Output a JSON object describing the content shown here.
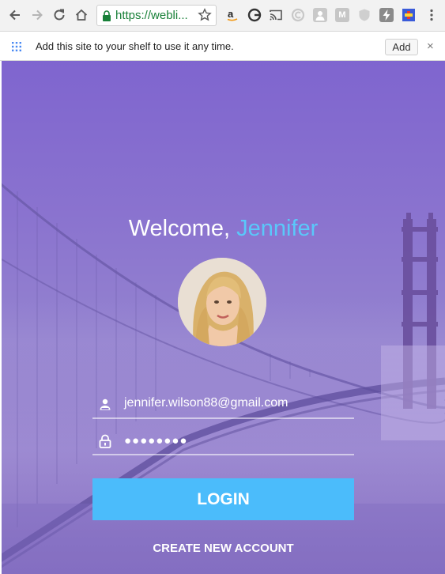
{
  "browser": {
    "url": "https://webli...",
    "extensions": [
      "amazon-icon",
      "grammarly-icon",
      "cast-icon",
      "c-icon",
      "profile-icon",
      "m-icon",
      "shield-icon",
      "lightning-icon",
      "flag-icon"
    ],
    "ext_m_label": "M"
  },
  "banner": {
    "message": "Add this site to your shelf to use it any time.",
    "add_label": "Add",
    "close_label": "×"
  },
  "login": {
    "welcome_prefix": "Welcome,",
    "welcome_name": "Jennifer",
    "email": "jennifer.wilson88@gmail.com",
    "password_mask": "●●●●●●●●",
    "login_label": "LOGIN",
    "create_account_label": "CREATE NEW ACCOUNT"
  },
  "colors": {
    "accent": "#4bbcfb",
    "name_highlight": "#5ac8fa",
    "background": "#8a73cf"
  }
}
